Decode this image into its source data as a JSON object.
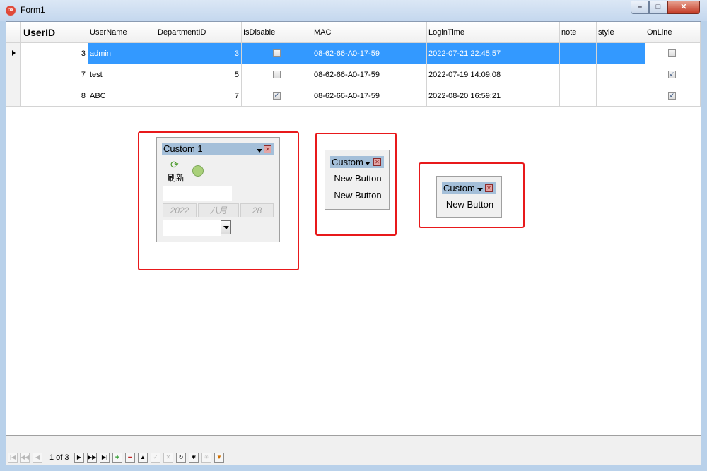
{
  "window": {
    "title": "Form1",
    "icon_label": "DX",
    "controls": {
      "minimize": "–",
      "maximize": "□",
      "close": "✕"
    }
  },
  "grid": {
    "columns": [
      "UserID",
      "UserName",
      "DepartmentID",
      "IsDisable",
      "MAC",
      "LoginTime",
      "note",
      "style",
      "OnLine"
    ],
    "rows": [
      {
        "UserID": "3",
        "UserName": "admin",
        "DepartmentID": "3",
        "IsDisable": false,
        "MAC": "08-62-66-A0-17-59",
        "LoginTime": "2022-07-21 22:45:57",
        "note": "",
        "style": "",
        "OnLine": false,
        "selected": true
      },
      {
        "UserID": "7",
        "UserName": "test",
        "DepartmentID": "5",
        "IsDisable": false,
        "MAC": "08-62-66-A0-17-59",
        "LoginTime": "2022-07-19 14:09:08",
        "note": "",
        "style": "",
        "OnLine": true,
        "selected": false
      },
      {
        "UserID": "8",
        "UserName": "ABC",
        "DepartmentID": "7",
        "IsDisable": true,
        "MAC": "08-62-66-A0-17-59",
        "LoginTime": "2022-08-20 16:59:21",
        "note": "",
        "style": "",
        "OnLine": true,
        "selected": false
      }
    ]
  },
  "panels": {
    "panel1": {
      "title": "Custom 1",
      "refresh_label": "刷新",
      "date_year": "2022",
      "date_month": "八月",
      "date_day": "28"
    },
    "panel2": {
      "title": "Custom",
      "button1": "New Button",
      "button2": "New Button"
    },
    "panel3": {
      "title": "Custom",
      "button1": "New Button"
    }
  },
  "navigator": {
    "position_text": "1 of 3",
    "buttons": [
      "first",
      "prev-page",
      "prev",
      "next",
      "next-page",
      "last",
      "append",
      "delete",
      "edit",
      "post",
      "cancel",
      "refresh",
      "save-bookmark",
      "goto-bookmark",
      "filter"
    ]
  },
  "colors": {
    "selection": "#3399ff",
    "highlight_box": "#e8191b",
    "panel_title": "#a4bfd9"
  }
}
